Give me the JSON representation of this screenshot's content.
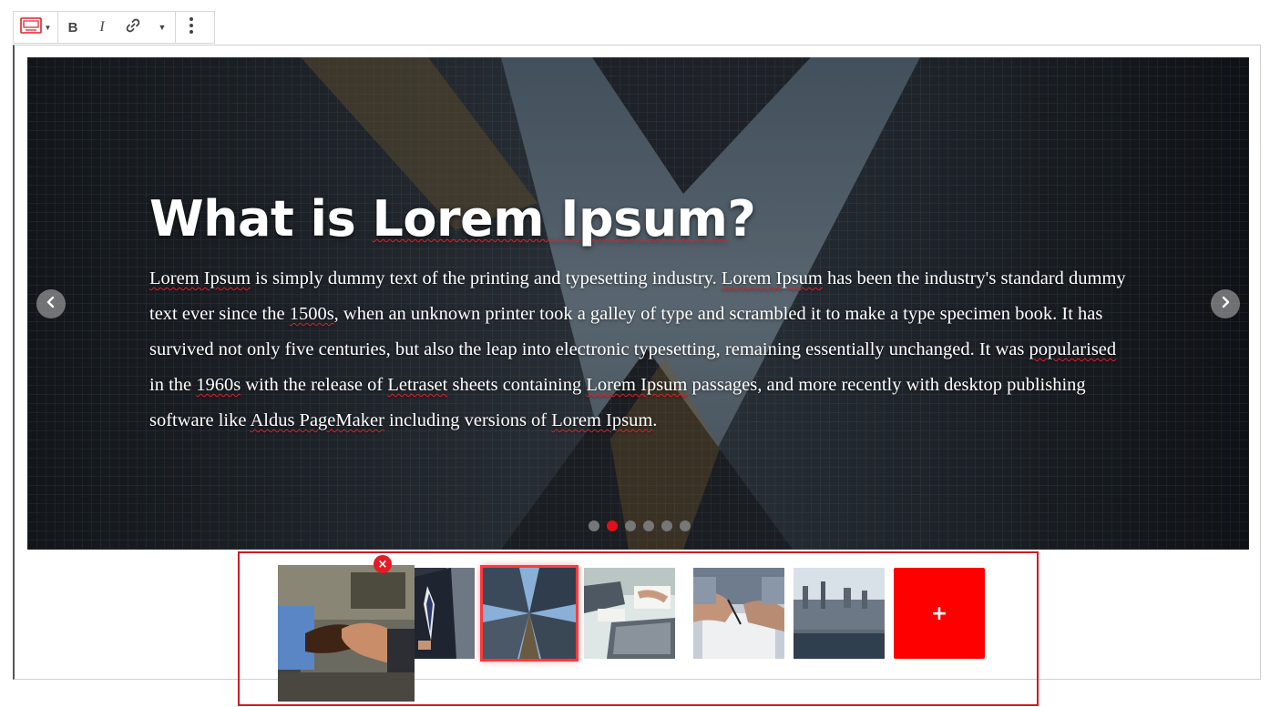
{
  "toolbar": {
    "block_type_icon": "slider-block-icon",
    "bold_label": "B",
    "italic_label": "I",
    "link_icon": "link-icon",
    "more_formatting_icon": "chevron-down-icon",
    "more_options_icon": "vertical-ellipsis-icon"
  },
  "slide": {
    "title": "What is Lorem Ipsum?",
    "body_segments": [
      {
        "text": "Lorem Ipsum",
        "spell": true
      },
      {
        "text": " is simply dummy text of the printing and typesetting industry. ",
        "spell": false
      },
      {
        "text": "Lorem Ipsum",
        "spell": true
      },
      {
        "text": " has been the industry's standard dummy text ever since the ",
        "spell": false
      },
      {
        "text": "1500s",
        "spell": true
      },
      {
        "text": ", when an unknown printer took a galley of type and scrambled it to make a type specimen book. It has survived not only five centuries, but also the leap into electronic typesetting, remaining essentially unchanged. It was ",
        "spell": false
      },
      {
        "text": "popularised",
        "spell": true
      },
      {
        "text": " in the ",
        "spell": false
      },
      {
        "text": "1960s",
        "spell": true
      },
      {
        "text": " with the release of ",
        "spell": false
      },
      {
        "text": "Letraset",
        "spell": true
      },
      {
        "text": " sheets containing ",
        "spell": false
      },
      {
        "text": "Lorem Ipsum",
        "spell": true
      },
      {
        "text": " passages, and more recently with desktop publishing software like ",
        "spell": false
      },
      {
        "text": "Aldus PageMaker",
        "spell": true
      },
      {
        "text": " including versions of ",
        "spell": false
      },
      {
        "text": "Lorem Ipsum",
        "spell": true
      },
      {
        "text": ".",
        "spell": false
      }
    ],
    "prev_icon": "chevron-left-icon",
    "next_icon": "chevron-right-icon",
    "dot_count": 6,
    "active_dot": 2
  },
  "thumbnails": [
    {
      "name": "handshake",
      "selected": false
    },
    {
      "name": "businessman-suit",
      "selected": false
    },
    {
      "name": "skyscrapers-looking-up",
      "selected": true
    },
    {
      "name": "laptop-meeting",
      "selected": false
    },
    {
      "name": "signing-document",
      "selected": false
    },
    {
      "name": "city-skyline",
      "selected": false
    }
  ],
  "remove_badge_icon": "close-icon",
  "remove_badge_glyph": "×",
  "add_button_label": "+",
  "colors": {
    "accent_red": "#ff0000",
    "active_dot": "#e0101c",
    "strip_border": "#d11a22"
  }
}
